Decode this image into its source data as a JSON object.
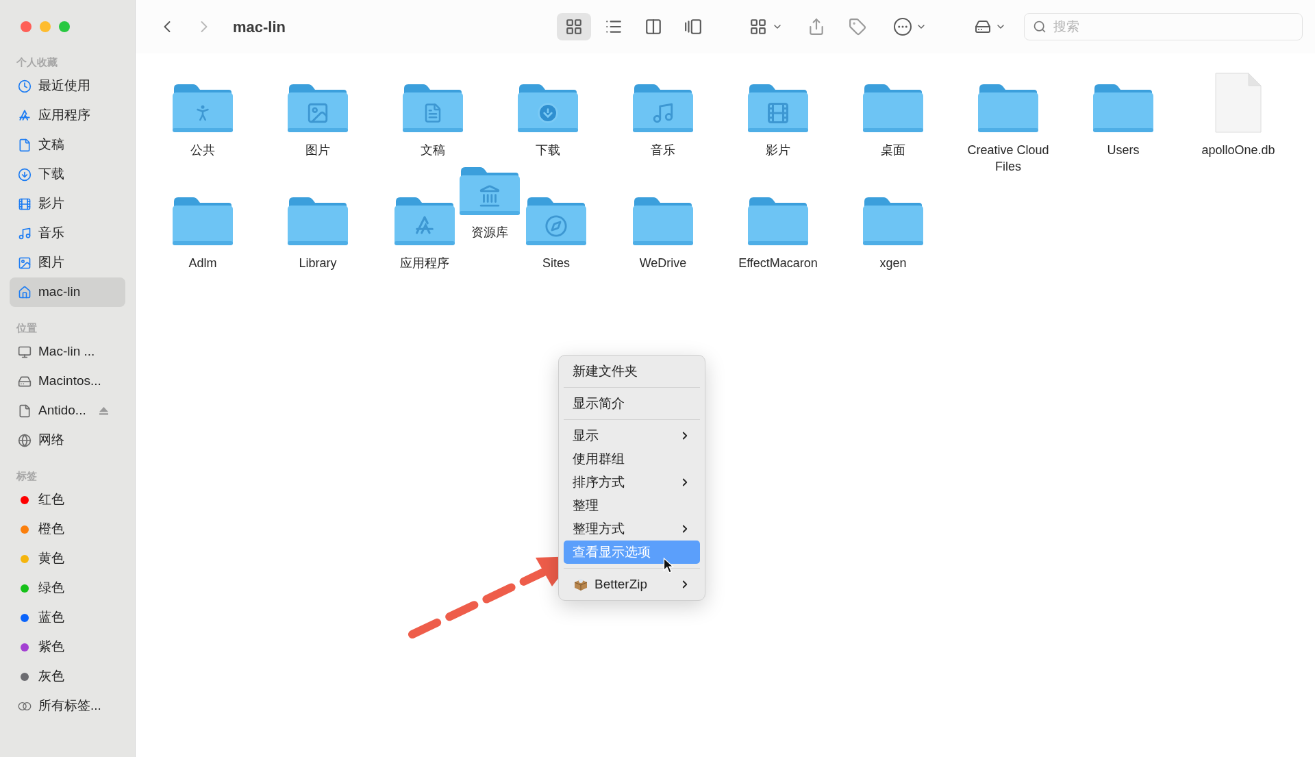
{
  "toolbar": {
    "back": {
      "disabled": false
    },
    "forward": {
      "disabled": true
    },
    "title": "mac-lin",
    "views": [
      {
        "kind": "icons",
        "selected": true
      },
      {
        "kind": "list",
        "selected": false
      },
      {
        "kind": "columns",
        "selected": false
      },
      {
        "kind": "gallery",
        "selected": false
      }
    ],
    "search": {
      "placeholder": "搜索"
    }
  },
  "sidebar": {
    "sections": [
      {
        "title": "个人收藏",
        "items": [
          {
            "kind": "recent",
            "label": "最近使用",
            "selected": false
          },
          {
            "kind": "apps",
            "label": "应用程序",
            "selected": false
          },
          {
            "kind": "documents",
            "label": "文稿",
            "selected": false
          },
          {
            "kind": "downloads",
            "label": "下载",
            "selected": false
          },
          {
            "kind": "movies",
            "label": "影片",
            "selected": false
          },
          {
            "kind": "music",
            "label": "音乐",
            "selected": false
          },
          {
            "kind": "pictures",
            "label": "图片",
            "selected": false
          },
          {
            "kind": "home",
            "label": "mac-lin",
            "selected": true
          }
        ]
      },
      {
        "title": "位置",
        "items": [
          {
            "kind": "computer",
            "label": "Mac-lin ...",
            "selected": false
          },
          {
            "kind": "disk",
            "label": "Macintos...",
            "selected": false
          },
          {
            "kind": "volume",
            "label": "Antido...",
            "selected": false
          },
          {
            "kind": "network",
            "label": "网络",
            "selected": false
          }
        ]
      },
      {
        "title": "标签",
        "items": [
          {
            "kind": "tag",
            "label": "红色",
            "color": "#fe0000",
            "selected": false
          },
          {
            "kind": "tag",
            "label": "橙色",
            "color": "#fb7f0c",
            "selected": false
          },
          {
            "kind": "tag",
            "label": "黄色",
            "color": "#f5b50d",
            "selected": false
          },
          {
            "kind": "tag",
            "label": "绿色",
            "color": "#16c119",
            "selected": false
          },
          {
            "kind": "tag",
            "label": "蓝色",
            "color": "#0a64fb",
            "selected": false
          },
          {
            "kind": "tag",
            "label": "紫色",
            "color": "#a340d2",
            "selected": false
          },
          {
            "kind": "tag",
            "label": "灰色",
            "color": "#6c6c70",
            "selected": false
          },
          {
            "kind": "alltags",
            "label": "所有标签...",
            "selected": false
          }
        ]
      }
    ]
  },
  "files": [
    {
      "kind": "public",
      "name": "公共"
    },
    {
      "kind": "pictures",
      "name": "图片"
    },
    {
      "kind": "documents",
      "name": "文稿"
    },
    {
      "kind": "downloads",
      "name": "下载"
    },
    {
      "kind": "music",
      "name": "音乐"
    },
    {
      "kind": "movies",
      "name": "影片"
    },
    {
      "kind": "folder",
      "name": "桌面"
    },
    {
      "kind": "folder",
      "name": "Creative Cloud Files"
    },
    {
      "kind": "folder",
      "name": "Users"
    },
    {
      "kind": "file",
      "name": "apolloOne.db"
    },
    {
      "kind": "folder",
      "name": "Adlm"
    },
    {
      "kind": "folder",
      "name": "Library"
    },
    {
      "kind": "apps",
      "name": "应用程序"
    },
    {
      "kind": "sites",
      "name": "Sites"
    },
    {
      "kind": "folder",
      "name": "WeDrive"
    },
    {
      "kind": "folder",
      "name": "EffectMacaron"
    },
    {
      "kind": "folder",
      "name": "xgen"
    }
  ],
  "dragged_item": {
    "kind": "library",
    "name": "资源库"
  },
  "context_menu": {
    "sections": [
      [
        {
          "label": "新建文件夹",
          "submenu": false,
          "selected": false
        }
      ],
      [
        {
          "label": "显示简介",
          "submenu": false,
          "selected": false
        }
      ],
      [
        {
          "label": "显示",
          "submenu": true,
          "selected": false
        },
        {
          "label": "使用群组",
          "submenu": false,
          "selected": false
        },
        {
          "label": "排序方式",
          "submenu": true,
          "selected": false
        },
        {
          "label": "整理",
          "submenu": false,
          "selected": false
        },
        {
          "label": "整理方式",
          "submenu": true,
          "selected": false
        },
        {
          "label": "查看显示选项",
          "submenu": false,
          "selected": true
        }
      ],
      [
        {
          "label": "BetterZip",
          "submenu": true,
          "selected": false,
          "app_icon": true
        }
      ]
    ]
  }
}
